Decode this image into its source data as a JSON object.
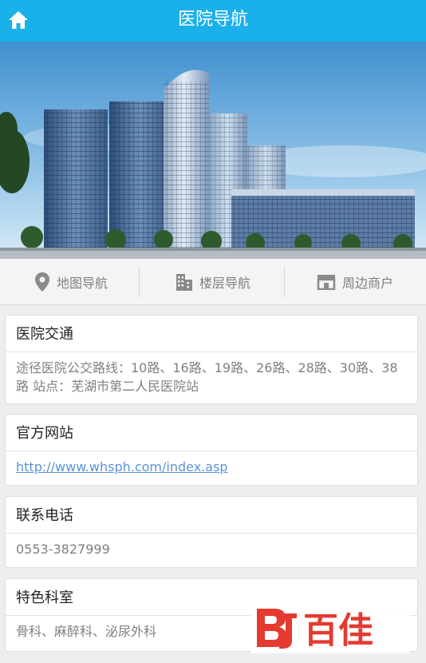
{
  "header": {
    "title": "医院导航",
    "home_icon": "home-icon"
  },
  "nav": {
    "items": [
      {
        "label": "地图导航",
        "icon": "map-pin-icon"
      },
      {
        "label": "楼层导航",
        "icon": "building-icon"
      },
      {
        "label": "周边商户",
        "icon": "store-icon"
      }
    ]
  },
  "sections": [
    {
      "title": "医院交通",
      "content": "途径医院公交路线：10路、16路、19路、26路、28路、30路、38路 站点：芜湖市第二人民医院站"
    },
    {
      "title": "官方网站",
      "content": "http://www.whsph.com/index.asp"
    },
    {
      "title": "联系电话",
      "content": "0553-3827999"
    },
    {
      "title": "特色科室",
      "content": "骨科、麻醉科、泌尿外科"
    }
  ],
  "watermark": {
    "text": "百佳",
    "colors": {
      "bj": "#e53a2f"
    }
  },
  "colors": {
    "header": "#1ab0ea",
    "link": "#5b93d8"
  }
}
